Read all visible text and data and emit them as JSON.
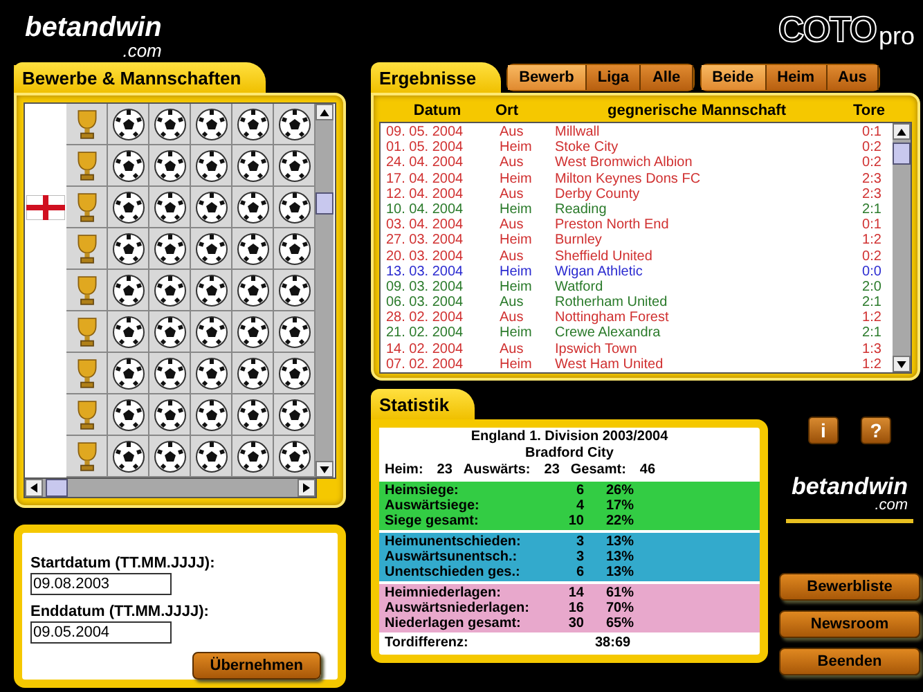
{
  "header": {
    "logo_main": "betandwin",
    "logo_sub": ".com",
    "product_logo": "COTO",
    "product_suffix": "pro"
  },
  "competitions": {
    "title": "Bewerbe & Mannschaften",
    "rows": [
      {
        "flag": false
      },
      {
        "flag": false
      },
      {
        "flag": true
      },
      {
        "flag": false
      },
      {
        "flag": false
      },
      {
        "flag": false
      },
      {
        "flag": false
      },
      {
        "flag": false
      },
      {
        "flag": false
      }
    ]
  },
  "date_form": {
    "start_label": "Startdatum (TT.MM.JJJJ):",
    "start_value": "09.08.2003",
    "end_label": "Enddatum  (TT.MM.JJJJ):",
    "end_value": "09.05.2004",
    "apply_button": "Übernehmen"
  },
  "results": {
    "title": "Ergebnisse",
    "filter_tabs": [
      {
        "label": "Bewerb",
        "selected": true
      },
      {
        "label": "Liga",
        "selected": false
      },
      {
        "label": "Alle",
        "selected": false
      }
    ],
    "venue_tabs": [
      {
        "label": "Beide",
        "selected": true
      },
      {
        "label": "Heim",
        "selected": false
      },
      {
        "label": "Aus",
        "selected": false
      }
    ],
    "columns": [
      "Datum",
      "Ort",
      "gegnerische Mannschaft",
      "Tore"
    ],
    "rows": [
      {
        "date": "09. 05. 2004",
        "venue": "Aus",
        "opponent": "Millwall",
        "score": "0:1",
        "color": "#d03030"
      },
      {
        "date": "01. 05. 2004",
        "venue": "Heim",
        "opponent": "Stoke City",
        "score": "0:2",
        "color": "#d03030"
      },
      {
        "date": "24. 04. 2004",
        "venue": "Aus",
        "opponent": "West Bromwich Albion",
        "score": "0:2",
        "color": "#d03030"
      },
      {
        "date": "17. 04. 2004",
        "venue": "Heim",
        "opponent": "Milton Keynes Dons FC",
        "score": "2:3",
        "color": "#d03030"
      },
      {
        "date": "12. 04. 2004",
        "venue": "Aus",
        "opponent": "Derby County",
        "score": "2:3",
        "color": "#d03030"
      },
      {
        "date": "10. 04. 2004",
        "venue": "Heim",
        "opponent": "Reading",
        "score": "2:1",
        "color": "#2a7a2a"
      },
      {
        "date": "03. 04. 2004",
        "venue": "Aus",
        "opponent": "Preston North End",
        "score": "0:1",
        "color": "#d03030"
      },
      {
        "date": "27. 03. 2004",
        "venue": "Heim",
        "opponent": "Burnley",
        "score": "1:2",
        "color": "#d03030"
      },
      {
        "date": "20. 03. 2004",
        "venue": "Aus",
        "opponent": "Sheffield United",
        "score": "0:2",
        "color": "#d03030"
      },
      {
        "date": "13. 03. 2004",
        "venue": "Heim",
        "opponent": "Wigan Athletic",
        "score": "0:0",
        "color": "#2a2ad0"
      },
      {
        "date": "09. 03. 2004",
        "venue": "Heim",
        "opponent": "Watford",
        "score": "2:0",
        "color": "#2a7a2a"
      },
      {
        "date": "06. 03. 2004",
        "venue": "Aus",
        "opponent": "Rotherham United",
        "score": "2:1",
        "color": "#2a7a2a"
      },
      {
        "date": "28. 02. 2004",
        "venue": "Aus",
        "opponent": "Nottingham Forest",
        "score": "1:2",
        "color": "#d03030"
      },
      {
        "date": "21. 02. 2004",
        "venue": "Heim",
        "opponent": "Crewe Alexandra",
        "score": "2:1",
        "color": "#2a7a2a"
      },
      {
        "date": "14. 02. 2004",
        "venue": "Aus",
        "opponent": "Ipswich Town",
        "score": "1:3",
        "color": "#d03030"
      },
      {
        "date": "07. 02. 2004",
        "venue": "Heim",
        "opponent": "West Ham United",
        "score": "1:2",
        "color": "#d03030"
      }
    ]
  },
  "statistics": {
    "title": "Statistik",
    "competition": "England 1. Division 2003/2004",
    "team": "Bradford City",
    "totals": [
      {
        "label": "Heim:",
        "value": "23"
      },
      {
        "label": "Auswärts:",
        "value": "23"
      },
      {
        "label": "Gesamt:",
        "value": "46"
      }
    ],
    "groups": [
      {
        "color": "#33cc44",
        "rows": [
          {
            "label": "Heimsiege:",
            "count": "6",
            "percent": "26%"
          },
          {
            "label": "Auswärtsiege:",
            "count": "4",
            "percent": "17%"
          },
          {
            "label": "Siege gesamt:",
            "count": "10",
            "percent": "22%"
          }
        ]
      },
      {
        "color": "#33aacc",
        "rows": [
          {
            "label": "Heimunentschieden:",
            "count": "3",
            "percent": "13%"
          },
          {
            "label": "Auswärtsunentsch.:",
            "count": "3",
            "percent": "13%"
          },
          {
            "label": "Unentschieden ges.:",
            "count": "6",
            "percent": "13%"
          }
        ]
      },
      {
        "color": "#e8a8cc",
        "rows": [
          {
            "label": "Heimniederlagen:",
            "count": "14",
            "percent": "61%"
          },
          {
            "label": "Auswärtsniederlagen:",
            "count": "16",
            "percent": "70%"
          },
          {
            "label": "Niederlagen gesamt:",
            "count": "30",
            "percent": "65%"
          }
        ]
      }
    ],
    "goal_diff_label": "Tordifferenz:",
    "goal_diff_value": "38:69"
  },
  "side": {
    "info_button": "i",
    "help_button": "?",
    "logo_main": "betandwin",
    "logo_sub": ".com",
    "buttons": [
      "Bewerbliste",
      "Newsroom",
      "Beenden"
    ]
  }
}
